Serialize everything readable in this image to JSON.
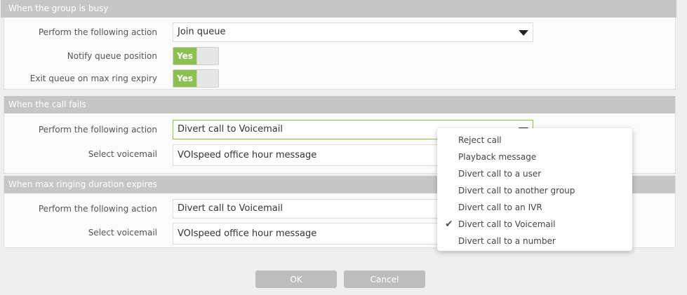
{
  "sections": {
    "busy": {
      "title": "When the group is busy",
      "action_label": "Perform the following action",
      "action_value": "Join queue",
      "notify_label": "Notify queue position",
      "notify_value": "Yes",
      "exit_label": "Exit queue on max ring expiry",
      "exit_value": "Yes"
    },
    "fails": {
      "title": "When the call fails",
      "action_label": "Perform the following action",
      "action_value": "Divert call to Voicemail",
      "voicemail_label": "Select voicemail",
      "voicemail_value": "VOIspeed office hour message"
    },
    "max_ring": {
      "title": "When max ringing duration expires",
      "action_label": "Perform the following action",
      "action_value": "Divert call to Voicemail",
      "voicemail_label": "Select voicemail",
      "voicemail_value": "VOIspeed office hour message"
    }
  },
  "dropdown": {
    "items": [
      {
        "label": "Reject call",
        "selected": false
      },
      {
        "label": "Playback message",
        "selected": false
      },
      {
        "label": "Divert call to a user",
        "selected": false
      },
      {
        "label": "Divert call to another group",
        "selected": false
      },
      {
        "label": "Divert call to an IVR",
        "selected": false
      },
      {
        "label": "Divert call to Voicemail",
        "selected": true
      },
      {
        "label": "Divert call to a number",
        "selected": false
      }
    ],
    "check_glyph": "✔"
  },
  "buttons": {
    "ok": "OK",
    "cancel": "Cancel"
  },
  "colors": {
    "accent_green": "#8cc152",
    "header_gray": "#c6c6c6",
    "button_gray": "#bdbdbd"
  }
}
